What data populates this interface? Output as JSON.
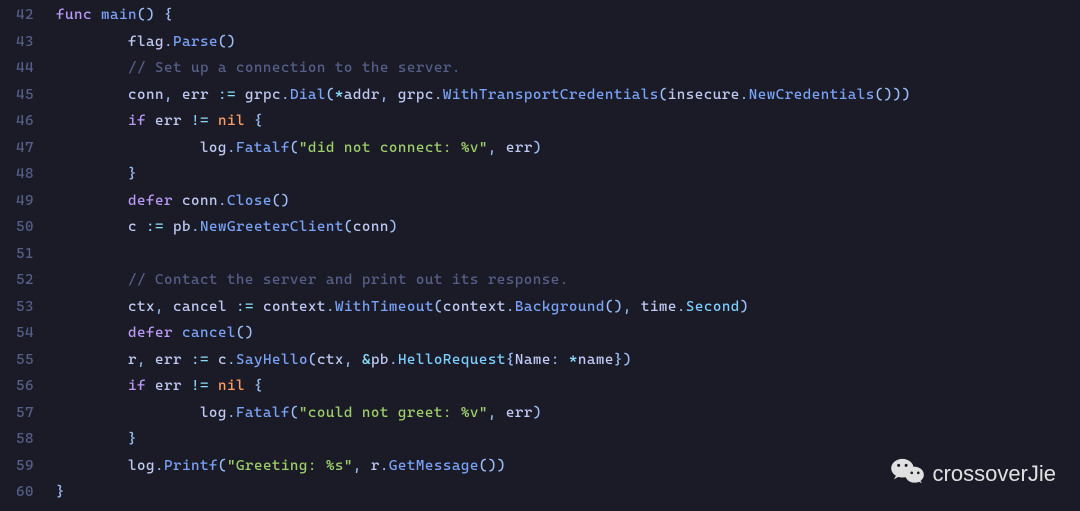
{
  "watermark": {
    "label": "crossoverJie"
  },
  "gutter": {
    "start": 42,
    "end": 60
  },
  "code": {
    "lines": [
      {
        "indent": 0,
        "tokens": [
          {
            "t": "kw",
            "v": "func"
          },
          {
            "t": "punct",
            "v": " "
          },
          {
            "t": "func",
            "v": "main"
          },
          {
            "t": "punct",
            "v": "() {"
          }
        ]
      },
      {
        "indent": 2,
        "tokens": [
          {
            "t": "pkg",
            "v": "flag"
          },
          {
            "t": "punct",
            "v": "."
          },
          {
            "t": "method",
            "v": "Parse"
          },
          {
            "t": "punct",
            "v": "()"
          }
        ]
      },
      {
        "indent": 2,
        "tokens": [
          {
            "t": "comment",
            "v": "// Set up a connection to the server."
          }
        ]
      },
      {
        "indent": 2,
        "tokens": [
          {
            "t": "ident",
            "v": "conn"
          },
          {
            "t": "punct",
            "v": ", "
          },
          {
            "t": "ident",
            "v": "err"
          },
          {
            "t": "punct",
            "v": " "
          },
          {
            "t": "op",
            "v": ":="
          },
          {
            "t": "punct",
            "v": " "
          },
          {
            "t": "pkg",
            "v": "grpc"
          },
          {
            "t": "punct",
            "v": "."
          },
          {
            "t": "method",
            "v": "Dial"
          },
          {
            "t": "punct",
            "v": "("
          },
          {
            "t": "op",
            "v": "*"
          },
          {
            "t": "ident",
            "v": "addr"
          },
          {
            "t": "punct",
            "v": ", "
          },
          {
            "t": "pkg",
            "v": "grpc"
          },
          {
            "t": "punct",
            "v": "."
          },
          {
            "t": "method",
            "v": "WithTransportCredentials"
          },
          {
            "t": "punct",
            "v": "("
          },
          {
            "t": "pkg",
            "v": "insecure"
          },
          {
            "t": "punct",
            "v": "."
          },
          {
            "t": "method",
            "v": "NewCredentials"
          },
          {
            "t": "punct",
            "v": "()))"
          }
        ]
      },
      {
        "indent": 2,
        "tokens": [
          {
            "t": "kw",
            "v": "if"
          },
          {
            "t": "punct",
            "v": " "
          },
          {
            "t": "ident",
            "v": "err"
          },
          {
            "t": "punct",
            "v": " "
          },
          {
            "t": "op",
            "v": "!="
          },
          {
            "t": "punct",
            "v": " "
          },
          {
            "t": "num",
            "v": "nil"
          },
          {
            "t": "punct",
            "v": " {"
          }
        ]
      },
      {
        "indent": 4,
        "tokens": [
          {
            "t": "pkg",
            "v": "log"
          },
          {
            "t": "punct",
            "v": "."
          },
          {
            "t": "method",
            "v": "Fatalf"
          },
          {
            "t": "punct",
            "v": "("
          },
          {
            "t": "str",
            "v": "\"did not connect: %v\""
          },
          {
            "t": "punct",
            "v": ", "
          },
          {
            "t": "ident",
            "v": "err"
          },
          {
            "t": "punct",
            "v": ")"
          }
        ]
      },
      {
        "indent": 2,
        "tokens": [
          {
            "t": "punct",
            "v": "}"
          }
        ]
      },
      {
        "indent": 2,
        "tokens": [
          {
            "t": "kw",
            "v": "defer"
          },
          {
            "t": "punct",
            "v": " "
          },
          {
            "t": "ident",
            "v": "conn"
          },
          {
            "t": "punct",
            "v": "."
          },
          {
            "t": "method",
            "v": "Close"
          },
          {
            "t": "punct",
            "v": "()"
          }
        ]
      },
      {
        "indent": 2,
        "tokens": [
          {
            "t": "ident",
            "v": "c"
          },
          {
            "t": "punct",
            "v": " "
          },
          {
            "t": "op",
            "v": ":="
          },
          {
            "t": "punct",
            "v": " "
          },
          {
            "t": "pkg",
            "v": "pb"
          },
          {
            "t": "punct",
            "v": "."
          },
          {
            "t": "method",
            "v": "NewGreeterClient"
          },
          {
            "t": "punct",
            "v": "("
          },
          {
            "t": "ident",
            "v": "conn"
          },
          {
            "t": "punct",
            "v": ")"
          }
        ]
      },
      {
        "indent": 0,
        "tokens": []
      },
      {
        "indent": 2,
        "tokens": [
          {
            "t": "comment",
            "v": "// Contact the server and print out its response."
          }
        ]
      },
      {
        "indent": 2,
        "tokens": [
          {
            "t": "ident",
            "v": "ctx"
          },
          {
            "t": "punct",
            "v": ", "
          },
          {
            "t": "ident",
            "v": "cancel"
          },
          {
            "t": "punct",
            "v": " "
          },
          {
            "t": "op",
            "v": ":="
          },
          {
            "t": "punct",
            "v": " "
          },
          {
            "t": "pkg",
            "v": "context"
          },
          {
            "t": "punct",
            "v": "."
          },
          {
            "t": "method",
            "v": "WithTimeout"
          },
          {
            "t": "punct",
            "v": "("
          },
          {
            "t": "pkg",
            "v": "context"
          },
          {
            "t": "punct",
            "v": "."
          },
          {
            "t": "method",
            "v": "Background"
          },
          {
            "t": "punct",
            "v": "(), "
          },
          {
            "t": "pkg",
            "v": "time"
          },
          {
            "t": "punct",
            "v": "."
          },
          {
            "t": "type",
            "v": "Second"
          },
          {
            "t": "punct",
            "v": ")"
          }
        ]
      },
      {
        "indent": 2,
        "tokens": [
          {
            "t": "kw",
            "v": "defer"
          },
          {
            "t": "punct",
            "v": " "
          },
          {
            "t": "method",
            "v": "cancel"
          },
          {
            "t": "punct",
            "v": "()"
          }
        ]
      },
      {
        "indent": 2,
        "tokens": [
          {
            "t": "ident",
            "v": "r"
          },
          {
            "t": "punct",
            "v": ", "
          },
          {
            "t": "ident",
            "v": "err"
          },
          {
            "t": "punct",
            "v": " "
          },
          {
            "t": "op",
            "v": ":="
          },
          {
            "t": "punct",
            "v": " "
          },
          {
            "t": "ident",
            "v": "c"
          },
          {
            "t": "punct",
            "v": "."
          },
          {
            "t": "method",
            "v": "SayHello"
          },
          {
            "t": "punct",
            "v": "("
          },
          {
            "t": "ident",
            "v": "ctx"
          },
          {
            "t": "punct",
            "v": ", "
          },
          {
            "t": "op",
            "v": "&"
          },
          {
            "t": "pkg",
            "v": "pb"
          },
          {
            "t": "punct",
            "v": "."
          },
          {
            "t": "type",
            "v": "HelloRequest"
          },
          {
            "t": "punct",
            "v": "{"
          },
          {
            "t": "ident",
            "v": "Name"
          },
          {
            "t": "punct",
            "v": ": "
          },
          {
            "t": "op",
            "v": "*"
          },
          {
            "t": "ident",
            "v": "name"
          },
          {
            "t": "punct",
            "v": "})"
          }
        ]
      },
      {
        "indent": 2,
        "tokens": [
          {
            "t": "kw",
            "v": "if"
          },
          {
            "t": "punct",
            "v": " "
          },
          {
            "t": "ident",
            "v": "err"
          },
          {
            "t": "punct",
            "v": " "
          },
          {
            "t": "op",
            "v": "!="
          },
          {
            "t": "punct",
            "v": " "
          },
          {
            "t": "num",
            "v": "nil"
          },
          {
            "t": "punct",
            "v": " {"
          }
        ]
      },
      {
        "indent": 4,
        "tokens": [
          {
            "t": "pkg",
            "v": "log"
          },
          {
            "t": "punct",
            "v": "."
          },
          {
            "t": "method",
            "v": "Fatalf"
          },
          {
            "t": "punct",
            "v": "("
          },
          {
            "t": "str",
            "v": "\"could not greet: %v\""
          },
          {
            "t": "punct",
            "v": ", "
          },
          {
            "t": "ident",
            "v": "err"
          },
          {
            "t": "punct",
            "v": ")"
          }
        ]
      },
      {
        "indent": 2,
        "tokens": [
          {
            "t": "punct",
            "v": "}"
          }
        ]
      },
      {
        "indent": 2,
        "tokens": [
          {
            "t": "pkg",
            "v": "log"
          },
          {
            "t": "punct",
            "v": "."
          },
          {
            "t": "method",
            "v": "Printf"
          },
          {
            "t": "punct",
            "v": "("
          },
          {
            "t": "str",
            "v": "\"Greeting: %s\""
          },
          {
            "t": "punct",
            "v": ", "
          },
          {
            "t": "ident",
            "v": "r"
          },
          {
            "t": "punct",
            "v": "."
          },
          {
            "t": "method",
            "v": "GetMessage"
          },
          {
            "t": "punct",
            "v": "())"
          }
        ]
      },
      {
        "indent": 0,
        "tokens": [
          {
            "t": "punct",
            "v": "}"
          }
        ]
      }
    ]
  }
}
